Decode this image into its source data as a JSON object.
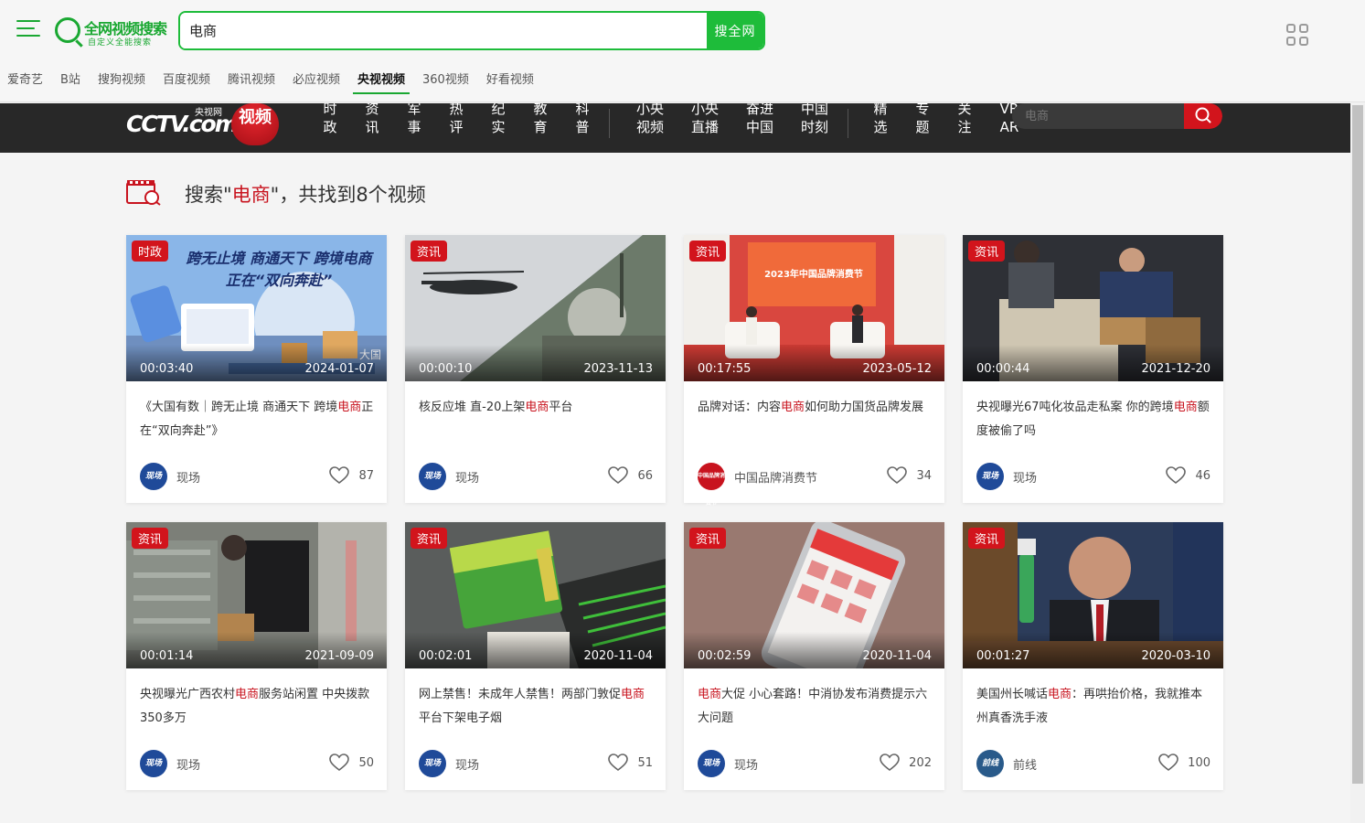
{
  "topbar": {
    "logo_title": "全网视频搜索",
    "logo_subtitle": "自定义全能搜索",
    "search_value": "电商",
    "search_button": "搜全网",
    "sites": [
      "爱奇艺",
      "B站",
      "搜狗视频",
      "百度视频",
      "腾讯视频",
      "必应视频",
      "央视视频",
      "360视频",
      "好看视频"
    ],
    "active_site_index": 6
  },
  "cctv": {
    "logo_text": "CCTV.com",
    "logo_small": "央视网",
    "logo_video": "视频",
    "nav_group1": [
      {
        "l1": "时",
        "l2": "政"
      },
      {
        "l1": "资",
        "l2": "讯"
      },
      {
        "l1": "军",
        "l2": "事"
      },
      {
        "l1": "热",
        "l2": "评"
      },
      {
        "l1": "纪",
        "l2": "实"
      },
      {
        "l1": "教",
        "l2": "育"
      },
      {
        "l1": "科",
        "l2": "普"
      }
    ],
    "nav_group2": [
      {
        "l1": "小央",
        "l2": "视频"
      },
      {
        "l1": "小央",
        "l2": "直播"
      },
      {
        "l1": "奋进",
        "l2": "中国"
      },
      {
        "l1": "中国",
        "l2": "时刻"
      }
    ],
    "nav_group3": [
      {
        "l1": "精",
        "l2": "选"
      },
      {
        "l1": "专",
        "l2": "题"
      },
      {
        "l1": "关",
        "l2": "注"
      },
      {
        "l1": "VR",
        "l2": "AR"
      }
    ],
    "search_placeholder": "电商"
  },
  "result": {
    "prefix": "搜索\"",
    "keyword": "电商",
    "suffix": "\"，共找到8个视频"
  },
  "videos": [
    {
      "badge": "时政",
      "duration": "00:03:40",
      "date": "2024-01-07",
      "title_parts": [
        "《大国有数｜跨无止境 商通天下 跨境",
        "电商",
        "正在“双向奔赴”》"
      ],
      "source": "现场",
      "likes": "87"
    },
    {
      "badge": "资讯",
      "duration": "00:00:10",
      "date": "2023-11-13",
      "title_parts": [
        "核反应堆 直-20上架",
        "电商",
        "平台"
      ],
      "source": "现场",
      "likes": "66"
    },
    {
      "badge": "资讯",
      "duration": "00:17:55",
      "date": "2023-05-12",
      "title_parts": [
        "品牌对话：内容",
        "电商",
        "如何助力国货品牌发展"
      ],
      "source": "中国品牌消费节",
      "likes": "34"
    },
    {
      "badge": "资讯",
      "duration": "00:00:44",
      "date": "2021-12-20",
      "title_parts": [
        "央视曝光67吨化妆品走私案 你的跨境",
        "电商",
        "额度被偷了吗"
      ],
      "source": "现场",
      "likes": "46"
    },
    {
      "badge": "资讯",
      "duration": "00:01:14",
      "date": "2021-09-09",
      "title_parts": [
        "央视曝光广西农村",
        "电商",
        "服务站闲置 中央拨款350多万"
      ],
      "source": "现场",
      "likes": "50"
    },
    {
      "badge": "资讯",
      "duration": "00:02:01",
      "date": "2020-11-04",
      "title_parts": [
        "网上禁售！未成年人禁售！两部门敦促",
        "电商",
        "平台下架电子烟"
      ],
      "source": "现场",
      "likes": "51"
    },
    {
      "badge": "资讯",
      "duration": "00:02:59",
      "date": "2020-11-04",
      "title_parts": [
        "",
        "电商",
        "大促 小心套路！中消协发布消费提示六大问题"
      ],
      "source": "现场",
      "likes": "202"
    },
    {
      "badge": "资讯",
      "duration": "00:01:27",
      "date": "2020-03-10",
      "title_parts": [
        "美国州长喊话",
        "电商",
        "：再哄抬价格，我就推本州真香洗手液"
      ],
      "source": "前线",
      "likes": "100"
    }
  ],
  "avatars": {
    "xianchang": "现场",
    "brand": "中国品牌消费节",
    "qianxian": "前线"
  },
  "colors": {
    "accent_green": "#1ebc3a",
    "cctv_red": "#d2141c",
    "keyword_red": "#c8131e",
    "nav_bg": "#282828"
  },
  "icons": [
    "menu-icon",
    "apps-grid-icon",
    "search-icon",
    "heart-icon",
    "result-film-icon"
  ],
  "thumb_captions": {
    "card1": "跨无止境 商通天下 跨境电商正在“双向奔赴”",
    "card1_corner": "大国",
    "card3": "2023年中国品牌消费节"
  }
}
